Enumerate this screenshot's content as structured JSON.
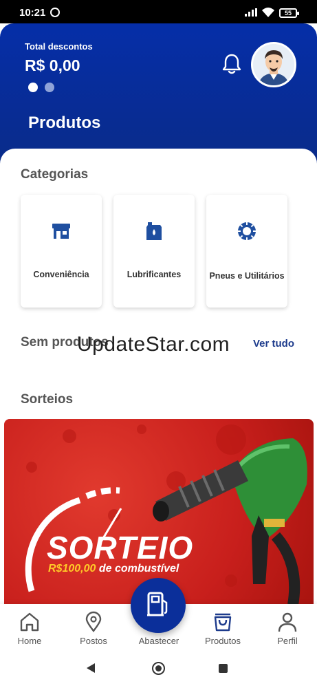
{
  "status_bar": {
    "time": "10:21",
    "battery": "55"
  },
  "header": {
    "total_label": "Total descontos",
    "total_value": "R$ 0,00",
    "page_title": "Produtos",
    "brand_color": "#052ea8"
  },
  "categories": {
    "title": "Categorias",
    "items": [
      {
        "label": "Conveniência",
        "icon": "store-icon"
      },
      {
        "label": "Lubrificantes",
        "icon": "oil-can-icon"
      },
      {
        "label": "Pneus e Utilitários",
        "icon": "tire-gear-icon"
      }
    ]
  },
  "products": {
    "title": "Sem produtos",
    "see_all": "Ver tudo"
  },
  "watermark": "UpdateStar.com",
  "raffles": {
    "title": "Sorteios",
    "banner_title": "SORTEIO",
    "banner_amount": "R$100,00",
    "banner_rest": " de combustível"
  },
  "bottom_nav": {
    "items": [
      {
        "label": "Home",
        "icon": "home-icon"
      },
      {
        "label": "Postos",
        "icon": "location-pin-icon"
      },
      {
        "label": "Abastecer",
        "icon": "fuel-pump-icon"
      },
      {
        "label": "Produtos",
        "icon": "shopping-bag-icon",
        "active": true
      },
      {
        "label": "Perfil",
        "icon": "person-icon"
      }
    ]
  },
  "accent_color": "#1d3b8c"
}
